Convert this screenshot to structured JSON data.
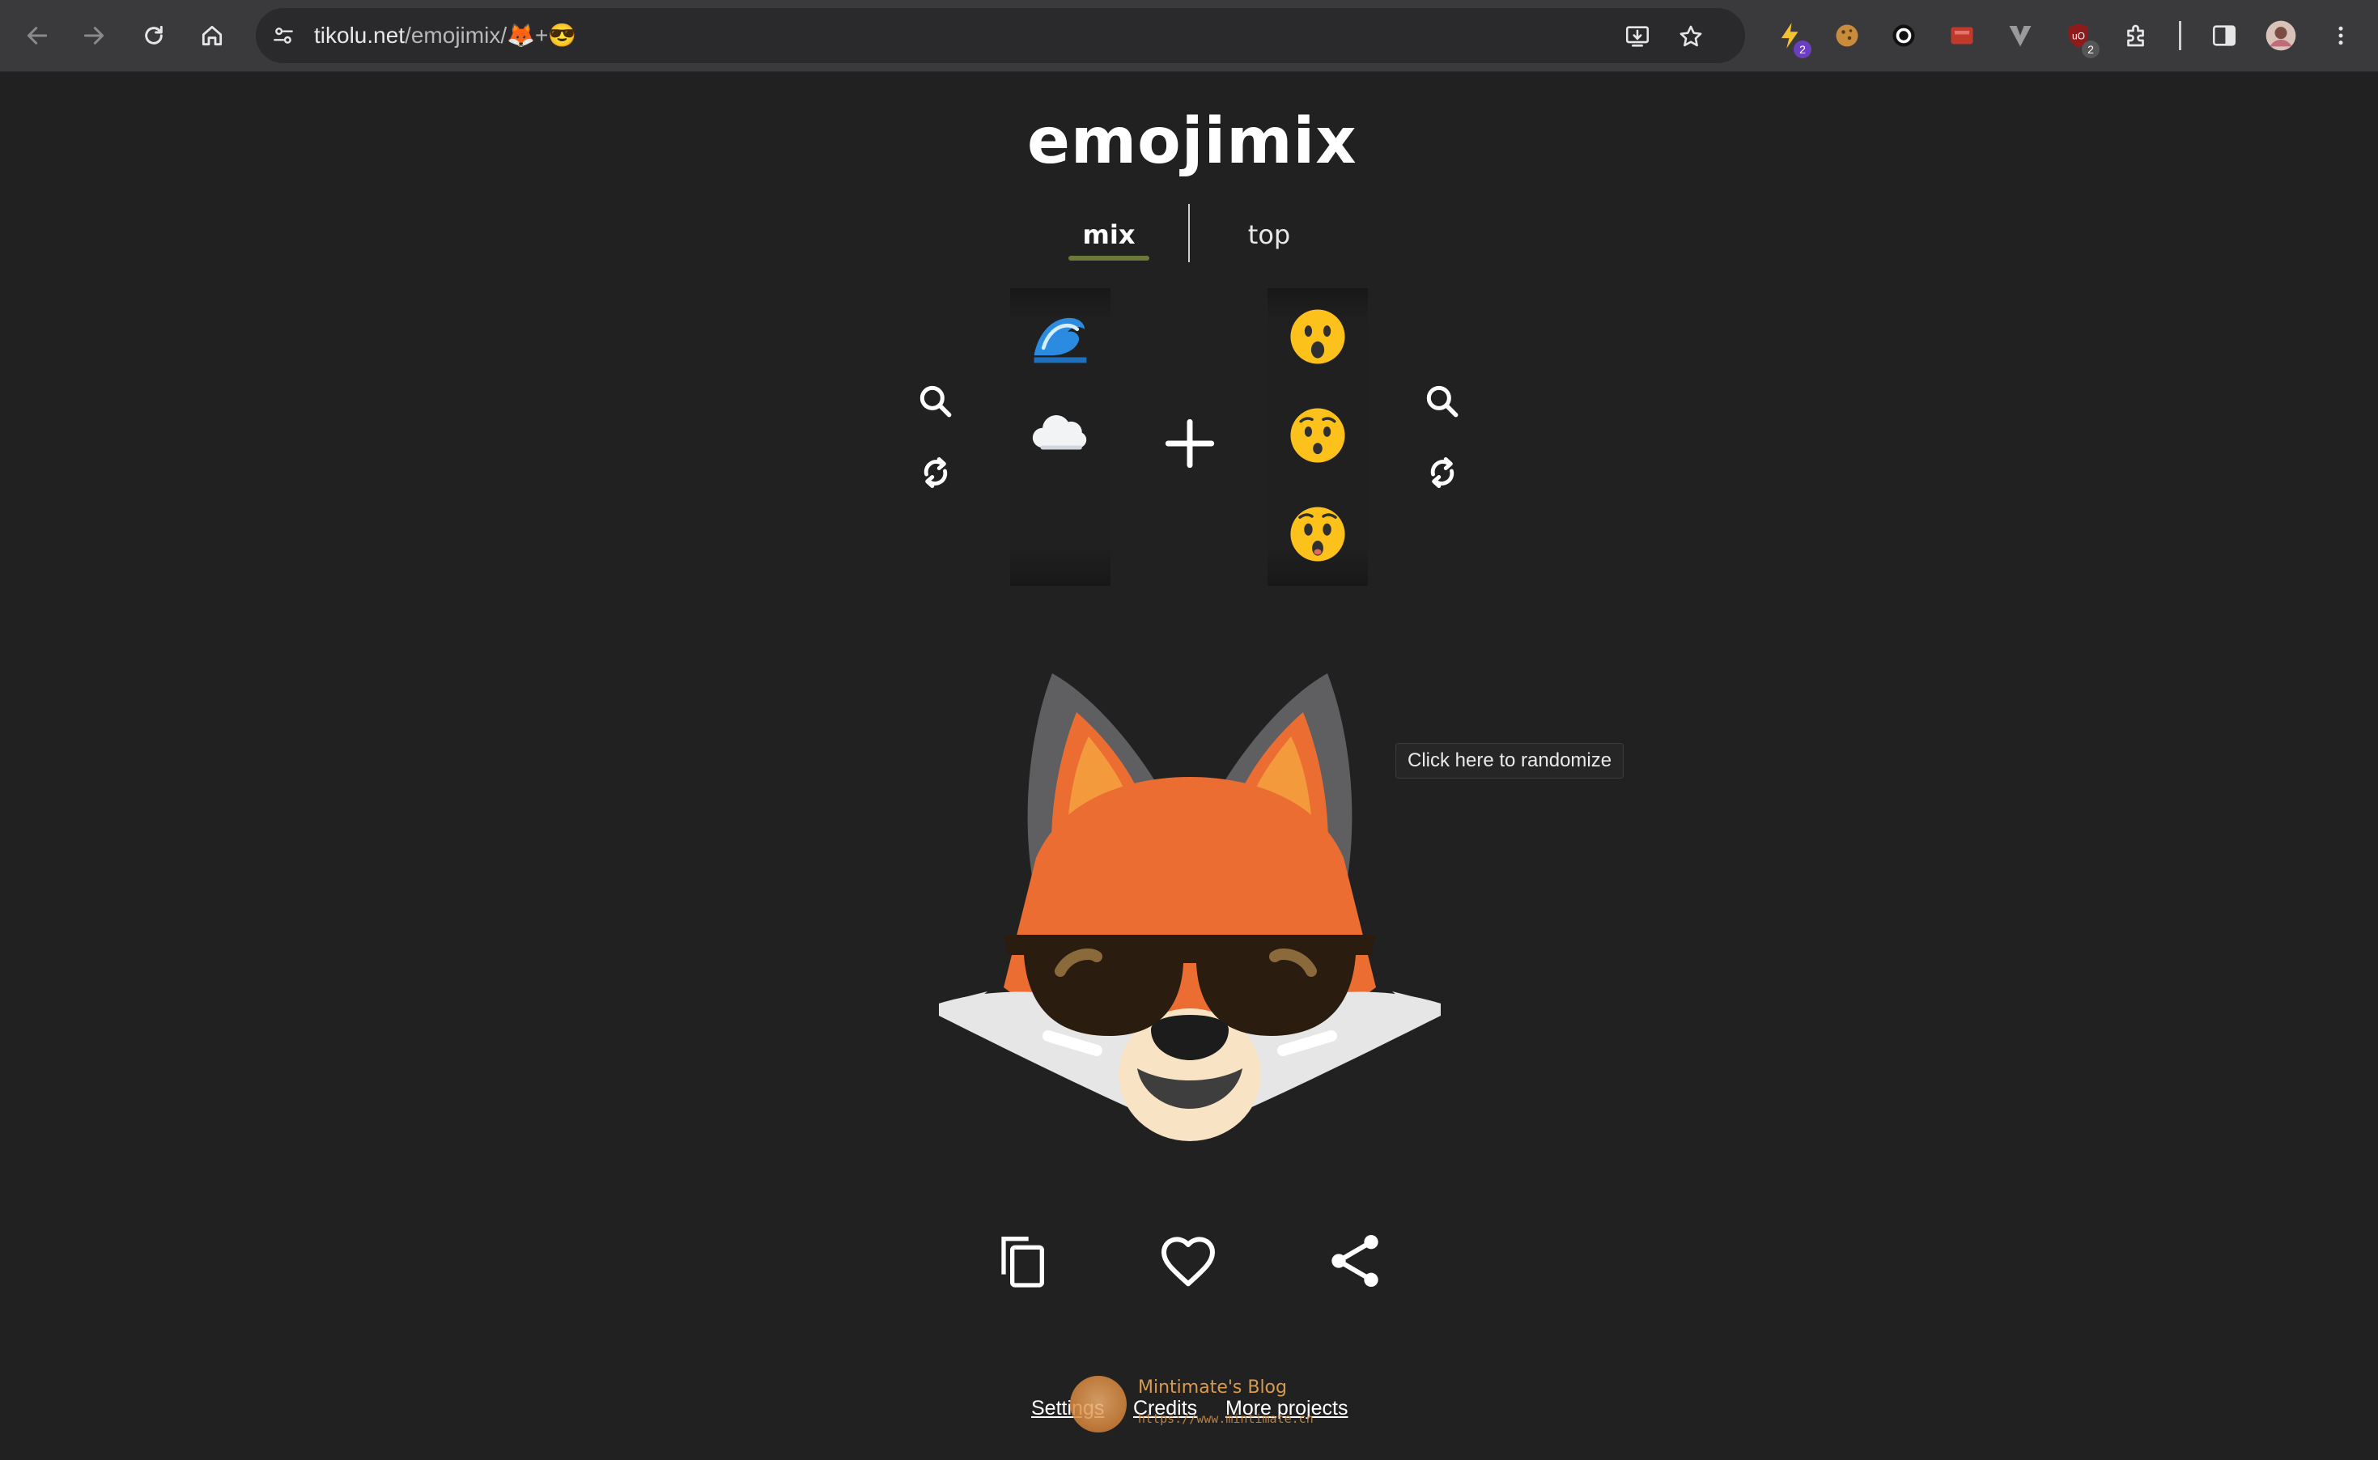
{
  "browser": {
    "url_host": "tikolu.net",
    "url_path": "/emojimix/🦊+😎",
    "badge_count_1": "2",
    "badge_count_2": "2"
  },
  "page": {
    "title": "emojimix",
    "tabs": [
      {
        "label": "mix",
        "selected": true
      },
      {
        "label": "top",
        "selected": false
      }
    ],
    "left_column": [
      "🌊",
      "☁️"
    ],
    "right_column": [
      "😮",
      "😯",
      "😲"
    ],
    "tooltip": "Click here to randomize",
    "result_description": "fox face wearing sunglasses",
    "actions": [
      "copy-icon",
      "heart-icon",
      "share-icon"
    ],
    "footer": {
      "settings": "Settings",
      "credits": "Credits",
      "more_projects": "More projects"
    },
    "watermark": {
      "title": "Mintimate's Blog",
      "subtitle": "https://www.mintimate.cn"
    }
  },
  "colors": {
    "background": "#212121",
    "chrome": "#3a3a3c",
    "tab_accent": "#6b7a3a"
  }
}
